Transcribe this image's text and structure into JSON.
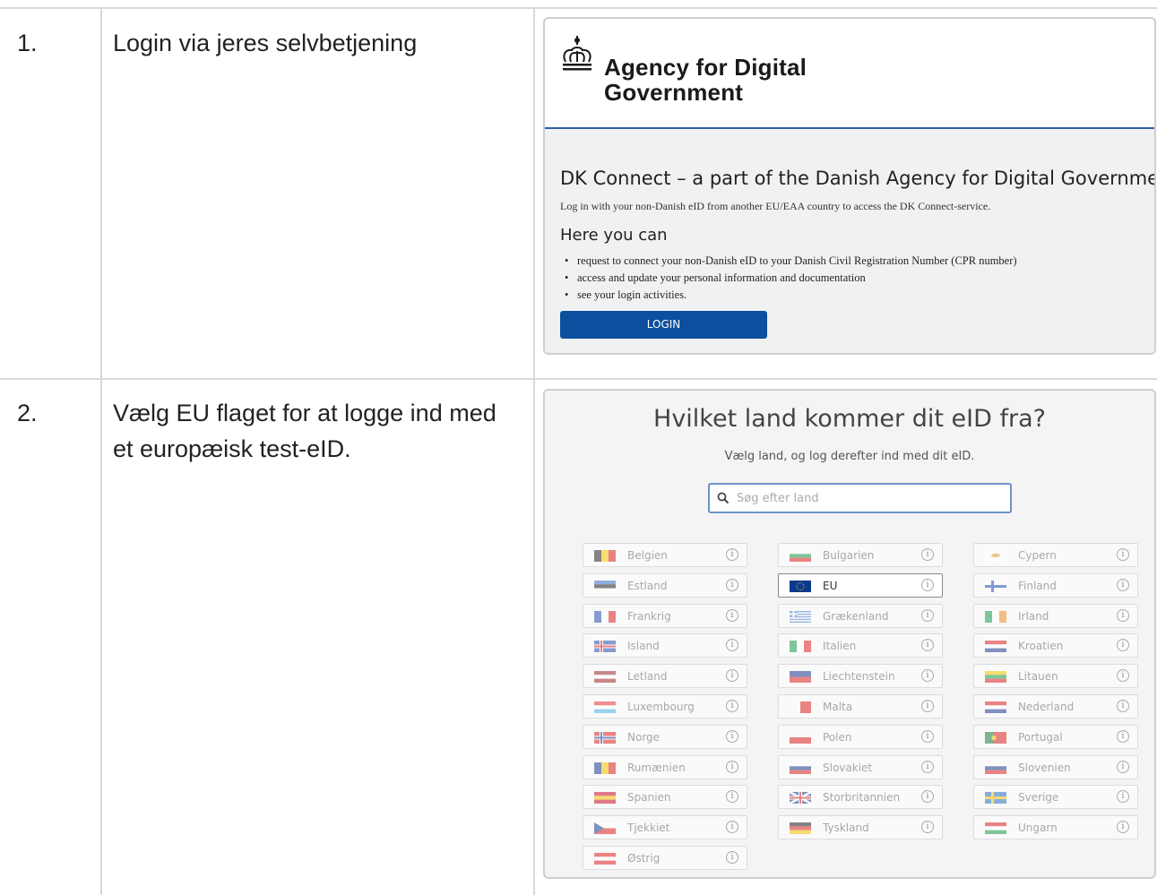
{
  "steps": [
    {
      "number": "1.",
      "text": "Login via jeres selvbetjening"
    },
    {
      "number": "2.",
      "text": "Vælg EU flaget for at logge ind med et europæisk test-eID."
    }
  ],
  "login_screen": {
    "brand_line1": "Agency for Digital",
    "brand_line2": "Government",
    "heading": "DK Connect – a part of the Danish Agency for Digital Government",
    "lead": "Log in with your non-Danish eID from another EU/EAA country to access the DK Connect-service.",
    "subheading": "Here you can",
    "bullets": [
      "request to connect your non-Danish eID to your Danish Civil Registration Number (CPR number)",
      "access and update your personal information and documentation",
      "see your login activities."
    ],
    "login_label": "LOGIN",
    "accent_color": "#0b4f9e"
  },
  "country_screen": {
    "question": "Hvilket land kommer dit eID fra?",
    "instruction": "Vælg land, og log derefter ind med dit eID.",
    "search_placeholder": "Søg efter land",
    "columns": [
      [
        "Belgien",
        "Estland",
        "Frankrig",
        "Island",
        "Letland",
        "Luxembourg",
        "Norge",
        "Rumænien",
        "Spanien",
        "Tjekkiet",
        "Østrig"
      ],
      [
        "Bulgarien",
        "EU",
        "Grækenland",
        "Italien",
        "Liechtenstein",
        "Malta",
        "Polen",
        "Slovakiet",
        "Storbritannien",
        "Tyskland"
      ],
      [
        "Cypern",
        "Finland",
        "Irland",
        "Kroatien",
        "Litauen",
        "Nederland",
        "Portugal",
        "Slovenien",
        "Sverige",
        "Ungarn"
      ]
    ],
    "selected": "EU",
    "info_icon": "info-icon",
    "search_icon": "search-icon"
  }
}
